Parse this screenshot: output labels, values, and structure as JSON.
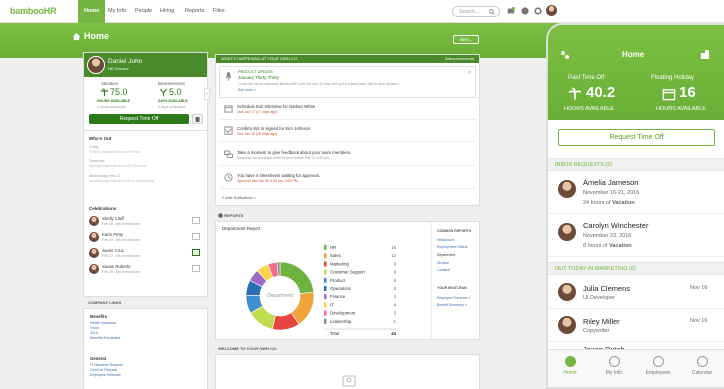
{
  "brand": {
    "logo": "bambooHR",
    "accent": "#74b63f"
  },
  "nav": {
    "items": [
      "Home",
      "My Info",
      "People",
      "Hiring",
      "Reports",
      "Files"
    ],
    "search_placeholder": "Search..."
  },
  "page": {
    "title": "Home",
    "new_button": "New..."
  },
  "profile": {
    "name": "Daniel John",
    "role": "HR Director",
    "vacation_label": "Vacation",
    "vacation_value": "75.0",
    "vacation_sub": "HOURS AVAILABLE",
    "bereavement_label": "Bereavement",
    "bereavement_value": "5.0",
    "bereavement_sub": "DAYS AVAILABLE",
    "request_button": "Request Time Off"
  },
  "whos_out": {
    "title": "Who's Out",
    "groups": [
      {
        "label": "Today",
        "text": "Nobody requested time off Today"
      },
      {
        "label": "Tomorrow",
        "text": "Nobody requested time off Tomorrow"
      },
      {
        "label": "Wednesday, Feb 21",
        "text": "Nobody requested time off for Wednesday"
      }
    ]
  },
  "celebrations": {
    "title": "Celebrations",
    "items": [
      {
        "name": "Shelly Cluff",
        "detail": "Feb 18 - 6th Anniversary"
      },
      {
        "name": "Karin Petty",
        "detail": "Feb 20 - 6th Anniversary"
      },
      {
        "name": "Javier Cruz",
        "detail": "Feb 22 - 6th Anniversary"
      },
      {
        "name": "Susan Roberts",
        "detail": "Feb 25 - 6th Anniversary"
      }
    ]
  },
  "company_links": {
    "title": "COMPANY LINKS",
    "groups": [
      {
        "label": "Benefits",
        "links": [
          "Health Insurance",
          "Vision",
          "401K",
          "Benefits Enrollment"
        ]
      },
      {
        "label": "General",
        "links": [
          "IT Helpdesk Request",
          "OrmCon Request",
          "Employee Referrals"
        ]
      }
    ]
  },
  "feed": {
    "header": "WHAT'S HAPPENING AT YOUR OWN CO.",
    "announcements_link": "Announcements",
    "items": [
      {
        "tag": "PRODUCT UPDATE",
        "title": "January Thirty Thirty",
        "body": "Looks like we've improved BambooHR over the last 30 days and got a repeat pass. We've also updated...",
        "link": "See more »"
      },
      {
        "title": "Schedule Exit Interview for Nathan White",
        "due": "Due Jan 17 (17 days ago)"
      },
      {
        "title": "Confirm W4 in signed for Kim Johnson",
        "due": "Due Jan 18 (18 days ago)"
      },
      {
        "title": "Take a moment to give feedback about your team members.",
        "due": "Requests for feedback must be sent before Feb 16 5:00 pm"
      },
      {
        "title": "You have 4 timesheets waiting for approval.",
        "due": "Approval due Jan 29 4:00 pm, 3:00 PM ..."
      }
    ],
    "older": "2 older Notifications »"
  },
  "reports": {
    "header": "REPORTS",
    "card_title": "Department Report",
    "center_label": "Department",
    "total_label": "Total",
    "total_value": "44",
    "common_title": "COMMON REPORTS",
    "common_links": [
      "Headcount",
      "Employment Status",
      "Department",
      "Division",
      "Location"
    ],
    "most_run_title": "YOUR MOST-RUN",
    "most_run_links": [
      "Employee Turnover »",
      "Benefit Summary »"
    ]
  },
  "chart_data": {
    "type": "pie",
    "categories": [
      "HR",
      "Sales",
      "Marketing",
      "Customer Support",
      "Product",
      "Operations",
      "Finance",
      "IT",
      "Development",
      "Leadership"
    ],
    "values": [
      16,
      12,
      9,
      9,
      6,
      5,
      4,
      4,
      3,
      1
    ],
    "colors": [
      "#6eb33f",
      "#f0a23b",
      "#e4453c",
      "#c2dc4f",
      "#3d8fd0",
      "#2a6fb5",
      "#9c6bc5",
      "#fcd24a",
      "#f26a8d",
      "#8a8a8a"
    ]
  },
  "welcome": {
    "header": "WELCOME TO YOUR OWN CO."
  },
  "phone": {
    "title": "Home",
    "pto_label": "Paid Time Off",
    "pto_value": "40.2",
    "pto_sub": "HOURS AVAILABLE",
    "fh_label": "Floating Holiday",
    "fh_value": "16",
    "fh_sub": "HOURS AVAILABLE",
    "request_button": "Request Time Off",
    "inbox_label": "INBOX REQUESTS (2)",
    "inbox": [
      {
        "name": "Amelia Jameson",
        "date": "November 16-21, 2016",
        "hours": "24 hours of",
        "type": "Vacation"
      },
      {
        "name": "Carolyn Winchester",
        "date": "November 23, 2016",
        "hours": "8 hours of",
        "type": "Vacation"
      }
    ],
    "out_label": "OUT TODAY IN MARKETING (6)",
    "out": [
      {
        "name": "Julia Clemens",
        "title": "UI Developer",
        "date": "Nov 16"
      },
      {
        "name": "Riley Miller",
        "title": "Copywriter",
        "date": "Nov 16"
      },
      {
        "name": "Jaxon Dutch",
        "title": "",
        "date": ""
      }
    ],
    "tabs": [
      "Home",
      "My Info",
      "Employees",
      "Calendar"
    ]
  }
}
